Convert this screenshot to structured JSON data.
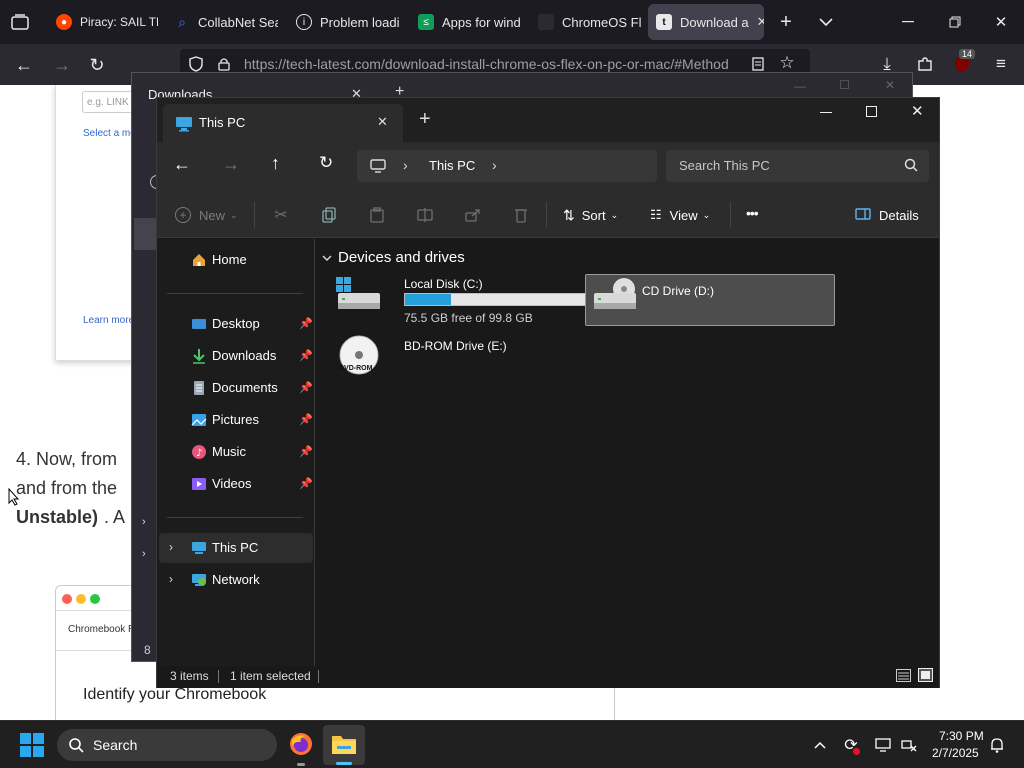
{
  "browser": {
    "tabs": [
      {
        "label": "Piracy: SAIL THE",
        "icon_color": "#ff4500",
        "active": false
      },
      {
        "label": "CollabNet Sea",
        "icon_color": "#4f6ef7",
        "active": false
      },
      {
        "label": "Problem loadin",
        "icon_color": "#e8e8e8",
        "active": false
      },
      {
        "label": "Apps for wind",
        "icon_color": "#0f9d58",
        "active": false
      },
      {
        "label": "ChromeOS Fle",
        "icon_color": "#2b2a33",
        "active": false
      },
      {
        "label": "Download a",
        "icon_color": "#222",
        "active": true
      }
    ],
    "url": "https://tech-latest.com/download-install-chrome-os-flex-on-pc-or-mac/#Method",
    "extension_badge": "14"
  },
  "webpage": {
    "input_placeholder": "e.g. LINK",
    "select_text": "Select a mo",
    "learn_more": "Learn more",
    "step_line1": "4. Now, from",
    "step_line2": "and from the",
    "step_line3_bold": "Unstable)",
    "step_line3_rest": ". A",
    "mac_title": "Chromebook R",
    "identify": "Identify your Chromebook"
  },
  "downloads_window": {
    "title": "Downloads",
    "count_fragment": "8"
  },
  "explorer": {
    "tab_title": "This PC",
    "breadcrumb": "This PC",
    "search_placeholder": "Search This PC",
    "toolbar": {
      "new_label": "New",
      "sort_label": "Sort",
      "view_label": "View",
      "more_label": "•••",
      "details_label": "Details"
    },
    "nav": {
      "home": "Home",
      "quick_access": [
        {
          "label": "Desktop",
          "icon": "desktop-icon",
          "color": "#3b8fd9"
        },
        {
          "label": "Downloads",
          "icon": "downloads-icon",
          "color": "#4cc764"
        },
        {
          "label": "Documents",
          "icon": "documents-icon",
          "color": "#9aa7b5"
        },
        {
          "label": "Pictures",
          "icon": "pictures-icon",
          "color": "#3aa0e8"
        },
        {
          "label": "Music",
          "icon": "music-icon",
          "color": "#e8567a"
        },
        {
          "label": "Videos",
          "icon": "videos-icon",
          "color": "#8b5cf6"
        }
      ],
      "this_pc": "This PC",
      "network": "Network"
    },
    "section_title": "Devices and drives",
    "drives": [
      {
        "name": "Local Disk (C:)",
        "free_text": "75.5 GB free of 99.8 GB",
        "used_fraction": 0.2435
      },
      {
        "name": "CD Drive (D:)",
        "selected": true
      },
      {
        "name": "BD-ROM Drive (E:)",
        "disc_label": "DVD-ROM"
      }
    ],
    "status": {
      "items": "3 items",
      "selected": "1 item selected"
    }
  },
  "taskbar": {
    "search_label": "Search",
    "time": "7:30 PM",
    "date": "2/7/2025"
  }
}
